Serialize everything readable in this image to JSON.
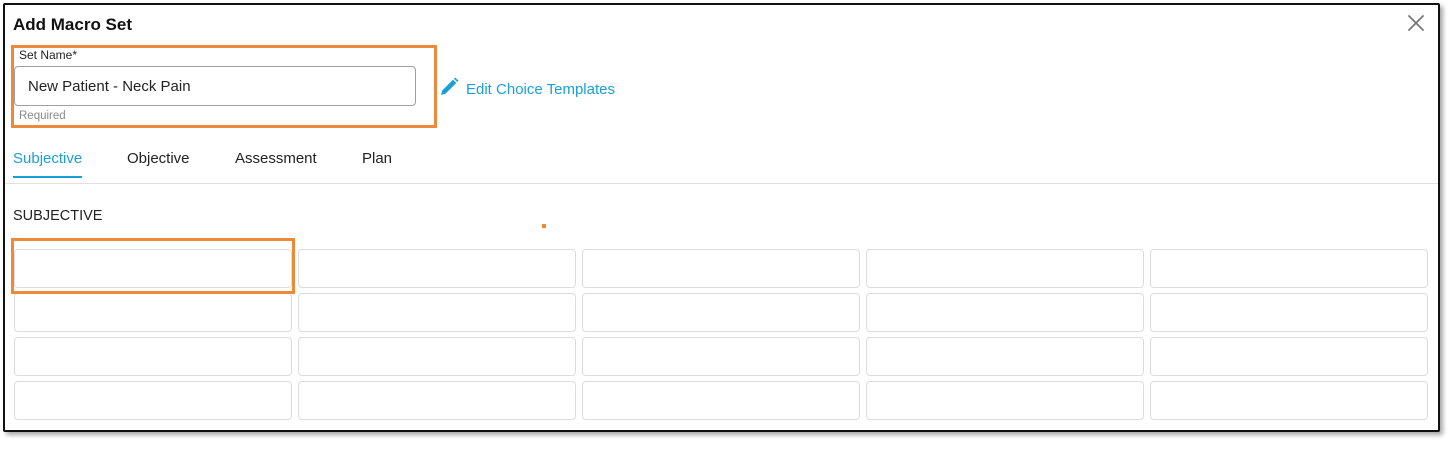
{
  "dialog": {
    "title": "Add Macro Set",
    "close_icon": "close-icon"
  },
  "set_name": {
    "label": "Set Name*",
    "value": "New Patient - Neck Pain",
    "helper": "Required"
  },
  "edit_link": {
    "icon": "pencil-icon",
    "label": "Edit Choice Templates"
  },
  "tabs": [
    {
      "label": "Subjective",
      "active": true
    },
    {
      "label": "Objective",
      "active": false
    },
    {
      "label": "Assessment",
      "active": false
    },
    {
      "label": "Plan",
      "active": false
    }
  ],
  "section": {
    "heading": "SUBJECTIVE",
    "grid_rows": 4,
    "grid_columns": 5,
    "cells": [
      "",
      "",
      "",
      "",
      "",
      "",
      "",
      "",
      "",
      "",
      "",
      "",
      "",
      "",
      "",
      "",
      "",
      "",
      "",
      ""
    ]
  },
  "colors": {
    "accent": "#1aa0d8",
    "highlight": "#ec8a3a",
    "border": "#dcdcdc"
  }
}
